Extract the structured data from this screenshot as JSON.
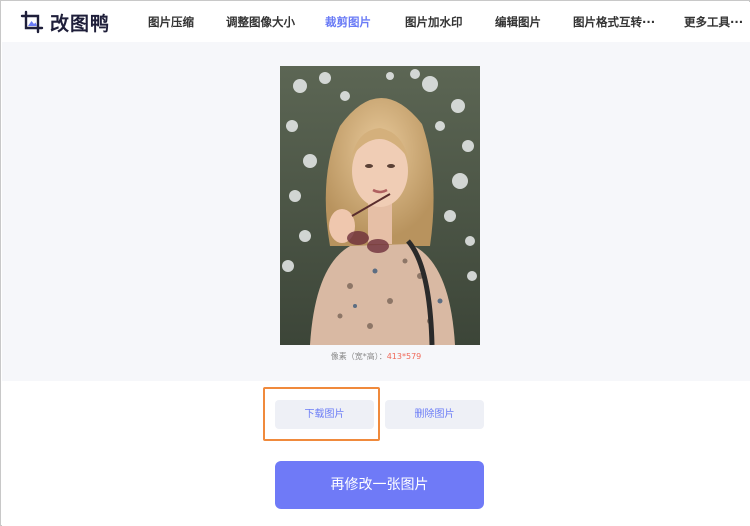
{
  "brand": {
    "name": "改图鸭",
    "logo_icon": "image-edit-logo-icon",
    "accent": "#6b7cf6"
  },
  "nav": [
    {
      "label": "图片压缩",
      "active": false
    },
    {
      "label": "调整图像大小",
      "active": false
    },
    {
      "label": "裁剪图片",
      "active": true
    },
    {
      "label": "图片加水印",
      "active": false
    },
    {
      "label": "编辑图片",
      "active": false
    },
    {
      "label": "图片格式互转···",
      "active": false
    },
    {
      "label": "更多工具···",
      "active": false
    }
  ],
  "preview": {
    "dims_label": "像素（宽*高）：",
    "dims_value": "413*579"
  },
  "actions": {
    "download_label": "下载图片",
    "delete_label": "删除图片",
    "redo_label": "再修改一张图片"
  },
  "colors": {
    "primary_button": "#6f7af7",
    "secondary_button_bg": "#eef0f6",
    "highlight_border": "#f08a3c",
    "dims_value": "#f06a5a"
  }
}
